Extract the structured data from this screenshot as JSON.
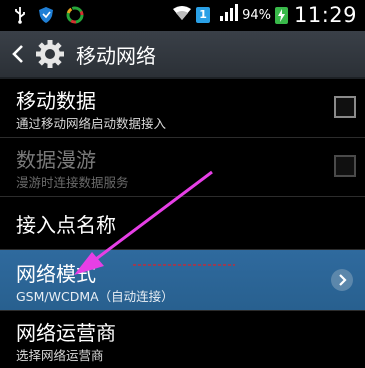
{
  "status_bar": {
    "sim_number": "1",
    "battery_percent": "94%",
    "time": "11:29"
  },
  "header": {
    "title": "移动网络"
  },
  "settings": [
    {
      "title": "移动数据",
      "subtitle": "通过移动网络启动数据接入",
      "checked": false,
      "enabled": true
    },
    {
      "title": "数据漫游",
      "subtitle": "漫游时连接数据服务",
      "checked": false,
      "enabled": false
    },
    {
      "title": "接入点名称"
    },
    {
      "title": "网络模式",
      "subtitle": "GSM/WCDMA（自动连接）"
    },
    {
      "title": "网络运营商",
      "subtitle": "选择网络运营商"
    }
  ],
  "colors": {
    "highlight": "#2f6a9e",
    "annotation_arrow": "#e63fe6"
  },
  "icons": {
    "status": [
      "usb-icon",
      "shield-icon",
      "sync-icon",
      "wifi-icon",
      "signal-icon",
      "battery-icon"
    ],
    "header": [
      "back-arrow-icon",
      "settings-gear-icon"
    ],
    "row": [
      "chevron-right-icon"
    ]
  }
}
